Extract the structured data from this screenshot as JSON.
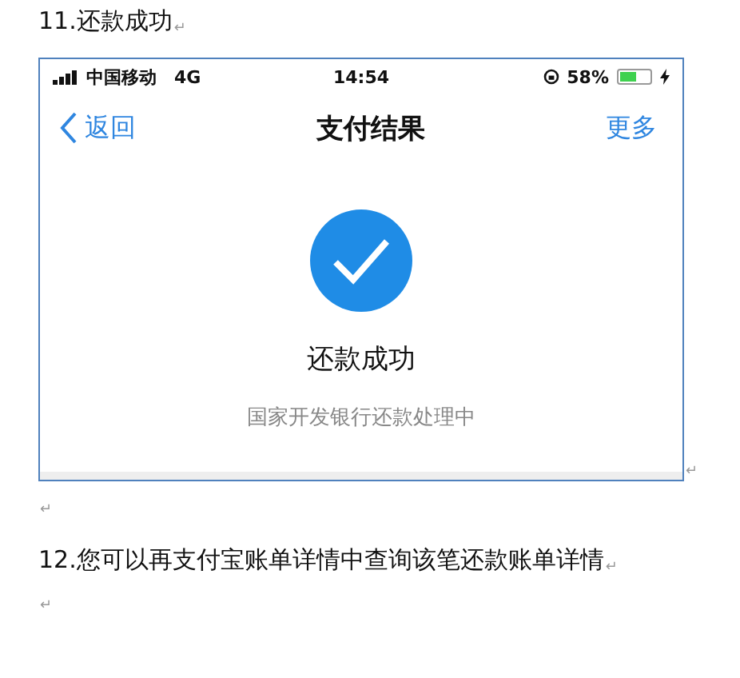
{
  "paragraphs": [
    {
      "kind": "text",
      "text": "11.还款成功",
      "mark": "↵"
    },
    {
      "kind": "screenshot",
      "mark": "↵",
      "status_bar": {
        "carrier": "中国移动",
        "network": "4G",
        "time": "14:54",
        "battery": "58%"
      },
      "nav": {
        "back": "返回",
        "title": "支付结果",
        "more": "更多"
      },
      "result": {
        "title": "还款成功",
        "subtitle": "国家开发银行还款处理中"
      }
    },
    {
      "kind": "empty",
      "mark": "↵"
    },
    {
      "kind": "text",
      "text": "12.您可以再支付宝账单详情中查询该笔还款账单详情",
      "mark": "↵"
    },
    {
      "kind": "empty",
      "mark": "↵"
    }
  ]
}
